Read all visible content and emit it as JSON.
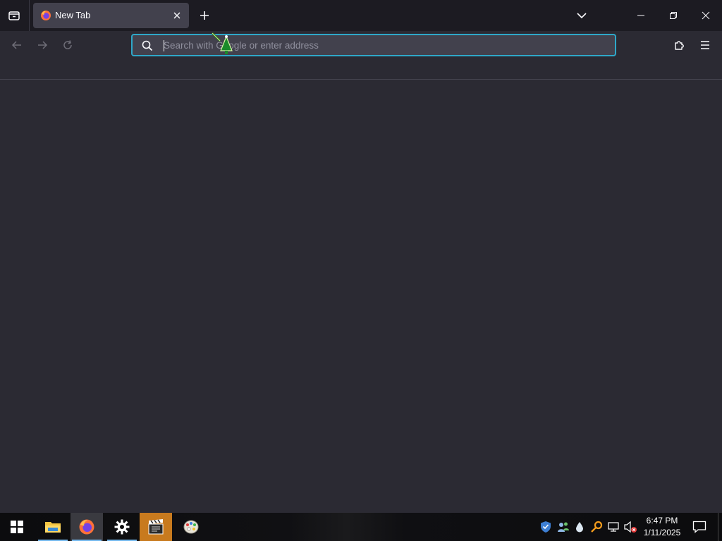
{
  "browser": {
    "tabs": [
      {
        "title": "New Tab",
        "favicon": "firefox-icon",
        "active": true
      }
    ],
    "urlbar": {
      "placeholder": "Search with Google or enter address",
      "value": ""
    },
    "icons": {
      "tab_list": "tab-list-icon",
      "new_tab": "plus-icon",
      "overflow": "chevron-down-icon",
      "back": "arrow-left-icon",
      "forward": "arrow-right-icon",
      "reload": "reload-icon",
      "extensions": "puzzle-icon",
      "menu": "hamburger-icon",
      "minimize": "minimize-icon",
      "maximize": "restore-icon",
      "close": "close-icon"
    },
    "colors": {
      "accent": "#2ea8c9",
      "toolbar": "#2b2a33",
      "tabstrip": "#1c1b22",
      "tab_active": "#42414d"
    }
  },
  "taskbar": {
    "apps": [
      {
        "name": "File Explorer",
        "icon": "folder-icon"
      },
      {
        "name": "Firefox",
        "icon": "firefox-icon"
      },
      {
        "name": "Settings",
        "icon": "gear-icon"
      },
      {
        "name": "Video editor",
        "icon": "clapperboard-icon"
      },
      {
        "name": "Paint",
        "icon": "palette-icon"
      }
    ],
    "tray_icons": [
      "shield-icon",
      "people-icon",
      "droplet-icon",
      "key-icon",
      "network-icon",
      "volume-muted-icon"
    ],
    "clock": {
      "time": "6:47 PM",
      "date": "1/11/2025"
    }
  }
}
